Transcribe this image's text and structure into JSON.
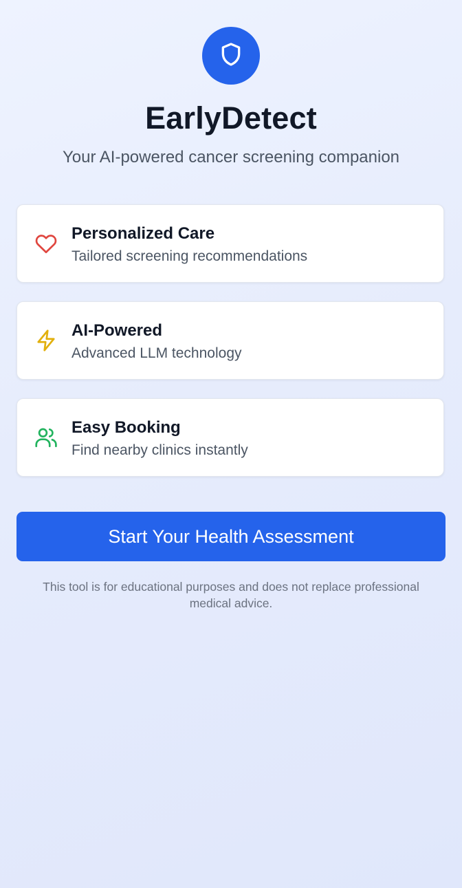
{
  "app": {
    "title": "EarlyDetect",
    "tagline": "Your AI-powered cancer screening companion",
    "logo_icon": "shield-icon"
  },
  "features": [
    {
      "icon": "heart-icon",
      "icon_color": "#e0463f",
      "title": "Personalized Care",
      "description": "Tailored screening recommendations"
    },
    {
      "icon": "lightning-bolt-icon",
      "icon_color": "#e2b00d",
      "title": "AI-Powered",
      "description": "Advanced LLM technology"
    },
    {
      "icon": "users-icon",
      "icon_color": "#22b35e",
      "title": "Easy Booking",
      "description": "Find nearby clinics instantly"
    }
  ],
  "cta": {
    "label": "Start Your Health Assessment"
  },
  "disclaimer": "This tool is for educational purposes and does not replace professional medical advice.",
  "colors": {
    "primary": "#2563eb",
    "background": "#e6ecfc",
    "heading": "#111827",
    "muted": "#4b5563"
  }
}
